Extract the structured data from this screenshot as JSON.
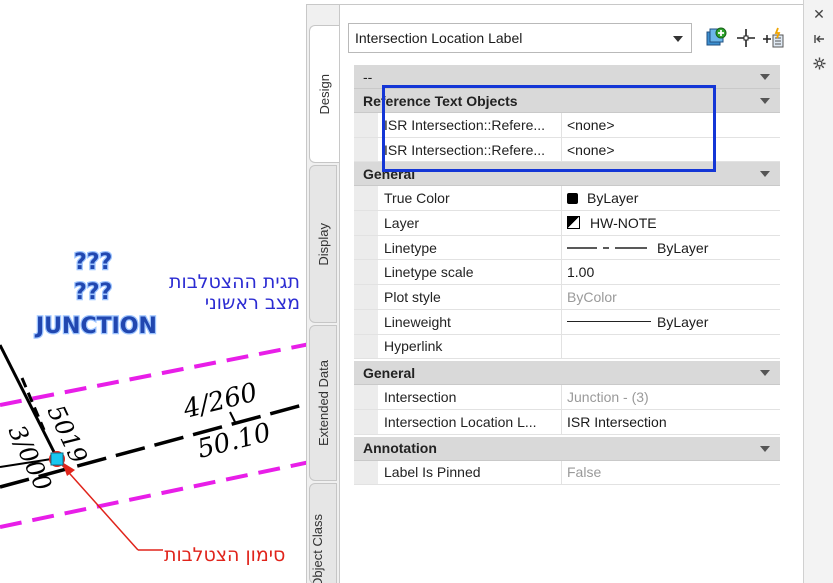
{
  "drawing": {
    "label_q1": "???",
    "label_q2": "???",
    "label_junction": "JUNCTION",
    "hebrew_label_line1": "תגית ההצטלבות",
    "hebrew_label_line2": "מצב ראשוני",
    "hebrew_marker": "סימון הצטלבות",
    "station_text": "4/260",
    "elevation_text": "50.10",
    "text_5019": "5019",
    "text_3000": "3/000"
  },
  "palette": {
    "tabs": [
      "Design",
      "Display",
      "Extended Data",
      "Object Class"
    ],
    "style_select": "Intersection Location Label"
  },
  "grid": {
    "top_category": "--",
    "reference": {
      "title": "Reference Text Objects",
      "rows": [
        {
          "name": "ISR  Intersection::Refere...",
          "value": "<none>"
        },
        {
          "name": "ISR  Intersection::Refere...",
          "value": "<none>"
        }
      ]
    },
    "general1": {
      "title": "General",
      "rows": [
        {
          "name": "True Color",
          "value": "ByLayer"
        },
        {
          "name": "Layer",
          "value": "HW-NOTE"
        },
        {
          "name": "Linetype",
          "value": "ByLayer"
        },
        {
          "name": "Linetype scale",
          "value": "1.00"
        },
        {
          "name": "Plot style",
          "value": "ByColor"
        },
        {
          "name": "Lineweight",
          "value": "ByLayer"
        },
        {
          "name": "Hyperlink",
          "value": ""
        }
      ]
    },
    "general2": {
      "title": "General",
      "rows": [
        {
          "name": "Intersection",
          "value": "Junction - (3)"
        },
        {
          "name": "Intersection Location L...",
          "value": "ISR Intersection"
        }
      ]
    },
    "annotation": {
      "title": "Annotation",
      "rows": [
        {
          "name": "Label Is Pinned",
          "value": "False"
        }
      ]
    }
  },
  "icons": {
    "add_style": "add-style-icon",
    "pick_point": "crosshair-icon",
    "quick_select": "quick-select-icon",
    "close": "close-icon",
    "auto_hide": "auto-hide-icon",
    "settings": "settings-icon"
  },
  "colors": {
    "highlight_box": "#1436d6",
    "road_dash": "#e81ee8",
    "label_blue": "#2147b0",
    "hebrew_blue": "#2b2bd2",
    "marker_red": "#e0241b"
  }
}
